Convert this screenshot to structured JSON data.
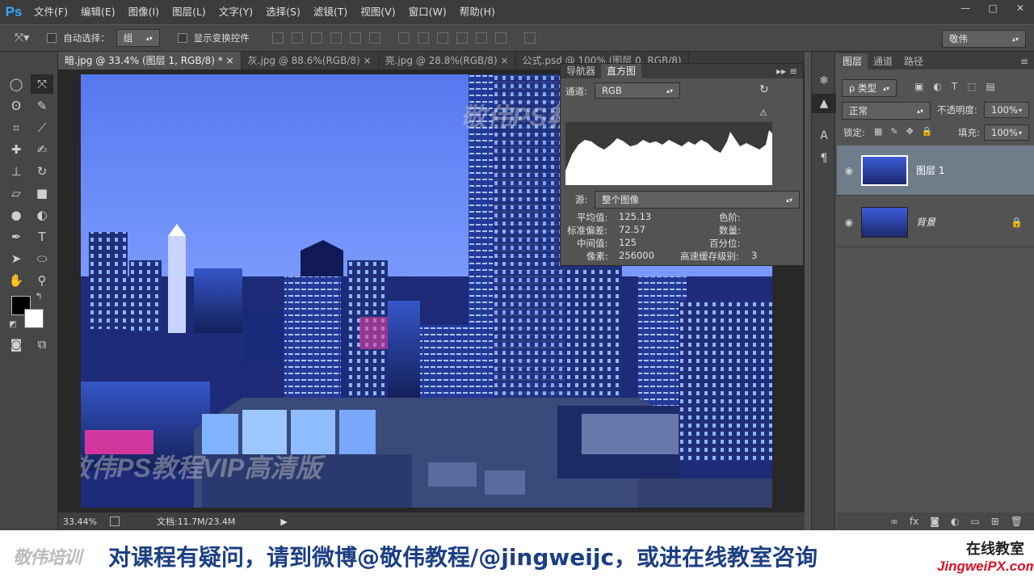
{
  "app": {
    "logo": "Ps"
  },
  "menu": [
    "文件(F)",
    "编辑(E)",
    "图像(I)",
    "图层(L)",
    "文字(Y)",
    "选择(S)",
    "滤镜(T)",
    "视图(V)",
    "窗口(W)",
    "帮助(H)"
  ],
  "window_controls": {
    "minimize": "—",
    "maximize": "□",
    "close": "✕"
  },
  "options": {
    "auto_select_label": "自动选择：",
    "auto_select_value": "组",
    "show_transform_label": "显示变换控件",
    "workspace": "敬伟"
  },
  "tabs": [
    {
      "label": "暗.jpg @ 33.4% (图层 1, RGB/8) *",
      "close": "×"
    },
    {
      "label": "灰.jpg @ 88.6%(RGB/8)",
      "close": "×"
    },
    {
      "label": "亮.jpg @ 28.8%(RGB/8)",
      "close": "×"
    },
    {
      "label": "公式.psd @ 100% (图层 0, RGB/8)",
      "close": ""
    }
  ],
  "status": {
    "zoom": "33.44%",
    "doc": "文档:11.7M/23.4M"
  },
  "histogram": {
    "tab_navigator": "导航器",
    "tab_histogram": "直方图",
    "channel_label": "通道:",
    "channel_value": "RGB",
    "source_label": "源:",
    "source_value": "整个图像",
    "mean_label": "平均值:",
    "mean_value": "125.13",
    "std_label": "标准偏差:",
    "std_value": "72.57",
    "median_label": "中间值:",
    "median_value": "125",
    "pixels_label": "像素:",
    "pixels_value": "256000",
    "level_label": "色阶:",
    "count_label": "数量:",
    "percentile_label": "百分位:",
    "cache_label": "高速缓存级别:",
    "cache_value": "3"
  },
  "layers": {
    "tabs": [
      "图层",
      "通道",
      "路径"
    ],
    "filter_kind": "ρ 类型",
    "blend_mode": "正常",
    "opacity_label": "不透明度:",
    "opacity_value": "100%",
    "lock_label": "锁定:",
    "fill_label": "填充:",
    "fill_value": "100%",
    "items": [
      {
        "name": "图层 1",
        "selected": true
      },
      {
        "name": "背景",
        "locked": true
      }
    ]
  },
  "watermark": "敬伟PS教程VIP高清版",
  "caption": {
    "logo": "敬伟培训",
    "text": "对课程有疑问，请到微博@敬伟教程/@jingweijc，或进在线教室咨询",
    "right_top": "在线教室",
    "right_bottom": "JingweiPX.com"
  }
}
